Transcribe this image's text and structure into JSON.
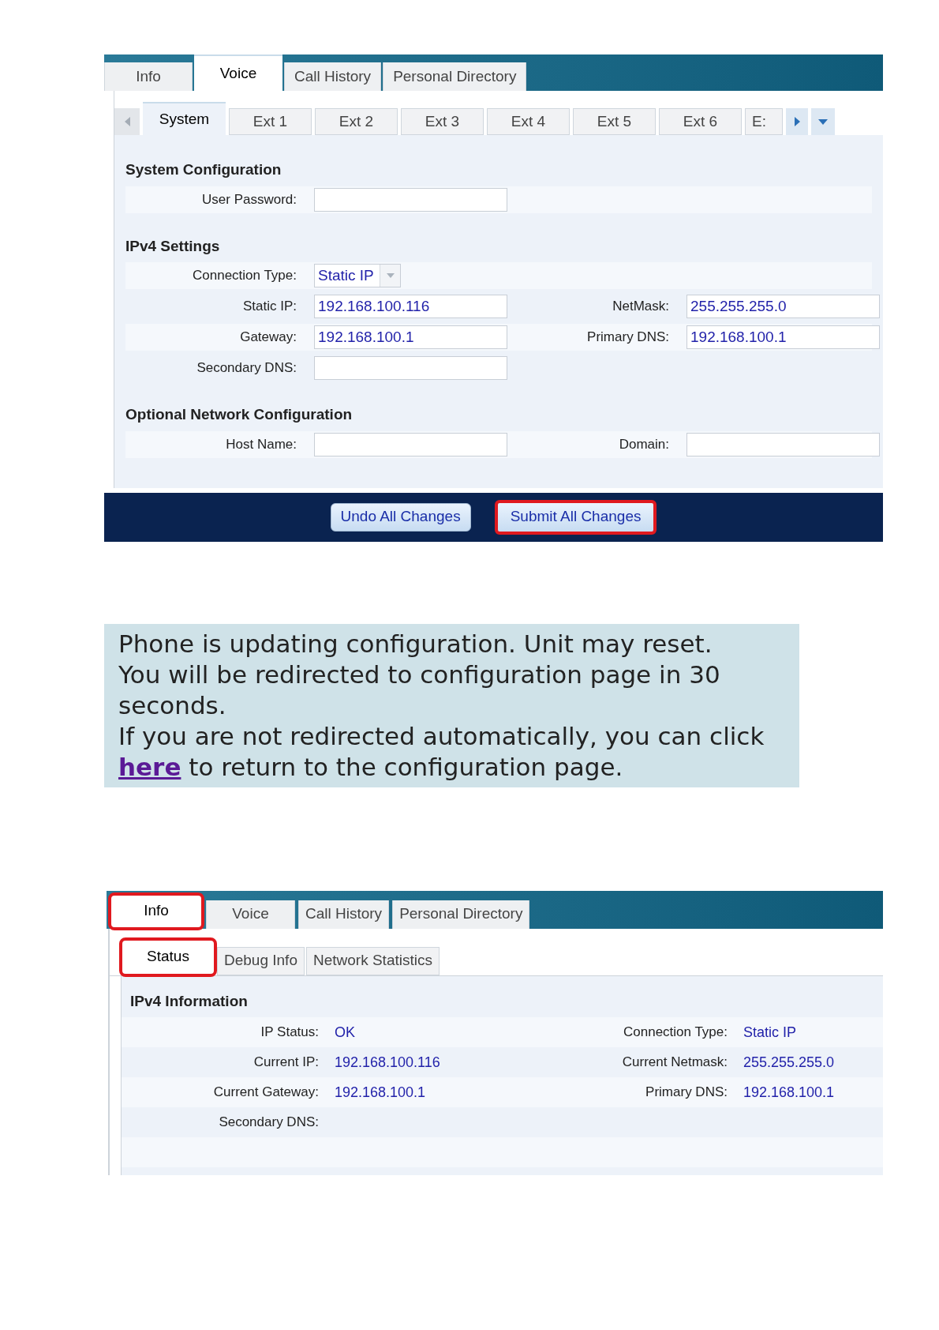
{
  "voice_screen": {
    "tabs": [
      {
        "label": "Info",
        "selected": false
      },
      {
        "label": "Voice",
        "selected": true
      },
      {
        "label": "Call History",
        "selected": false
      },
      {
        "label": "Personal Directory",
        "selected": false
      }
    ],
    "subtabs": [
      {
        "label": "System",
        "selected": true
      },
      {
        "label": "Ext 1",
        "selected": false
      },
      {
        "label": "Ext 2",
        "selected": false
      },
      {
        "label": "Ext 3",
        "selected": false
      },
      {
        "label": "Ext 4",
        "selected": false
      },
      {
        "label": "Ext 5",
        "selected": false
      },
      {
        "label": "Ext 6",
        "selected": false
      },
      {
        "label": "E:",
        "selected": false
      }
    ],
    "sections": [
      {
        "title": "System Configuration",
        "rows": [
          [
            {
              "kind": "text",
              "label": "User Password:"
            }
          ]
        ]
      },
      {
        "title": "IPv4 Settings",
        "rows": [
          [
            {
              "kind": "select",
              "label": "Connection Type:",
              "value": "Static IP"
            }
          ],
          [
            {
              "kind": "text",
              "label": "Static IP:",
              "value": "192.168.100.116"
            },
            {
              "kind": "text",
              "label": "NetMask:",
              "value": "255.255.255.0"
            }
          ],
          [
            {
              "kind": "text",
              "label": "Gateway:",
              "value": "192.168.100.1"
            },
            {
              "kind": "text",
              "label": "Primary DNS:",
              "value": "192.168.100.1"
            }
          ],
          [
            {
              "kind": "text",
              "label": "Secondary DNS:"
            }
          ]
        ]
      },
      {
        "title": "Optional Network Configuration",
        "rows": [
          [
            {
              "kind": "text",
              "label": "Host Name:"
            },
            {
              "kind": "text",
              "label": "Domain:"
            }
          ]
        ]
      }
    ],
    "buttons": [
      {
        "label": "Undo All Changes",
        "highlighted": false
      },
      {
        "label": "Submit All Changes",
        "highlighted": true
      }
    ]
  },
  "update_message": {
    "lines": [
      "Phone is updating configuration. Unit may reset.",
      "You will be redirected to configuration page in 30 seconds."
    ],
    "redirect_note": {
      "before": "If you are not redirected automatically, you can click",
      "link": "here",
      "after": "to return to the configuration page."
    }
  },
  "info_screen": {
    "tabs": [
      {
        "label": "Info",
        "selected": true,
        "highlighted": true
      },
      {
        "label": "Voice",
        "selected": false,
        "highlighted": false
      },
      {
        "label": "Call History",
        "selected": false,
        "highlighted": false
      },
      {
        "label": "Personal Directory",
        "selected": false,
        "highlighted": false
      }
    ],
    "subtabs": [
      {
        "label": "Status",
        "selected": true,
        "highlighted": true
      },
      {
        "label": "Debug Info",
        "selected": false,
        "highlighted": false
      },
      {
        "label": "Network Statistics",
        "selected": false,
        "highlighted": false
      }
    ],
    "section": {
      "title": "IPv4 Information",
      "rows": [
        [
          {
            "label": "IP Status:",
            "value": "OK"
          },
          {
            "label": "Connection Type:",
            "value": "Static IP"
          }
        ],
        [
          {
            "label": "Current IP:",
            "value": "192.168.100.116"
          },
          {
            "label": "Current Netmask:",
            "value": "255.255.255.0"
          }
        ],
        [
          {
            "label": "Current Gateway:",
            "value": "192.168.100.1"
          },
          {
            "label": "Primary DNS:",
            "value": "192.168.100.1"
          }
        ],
        [
          {
            "label": "Secondary DNS:"
          }
        ]
      ]
    }
  }
}
